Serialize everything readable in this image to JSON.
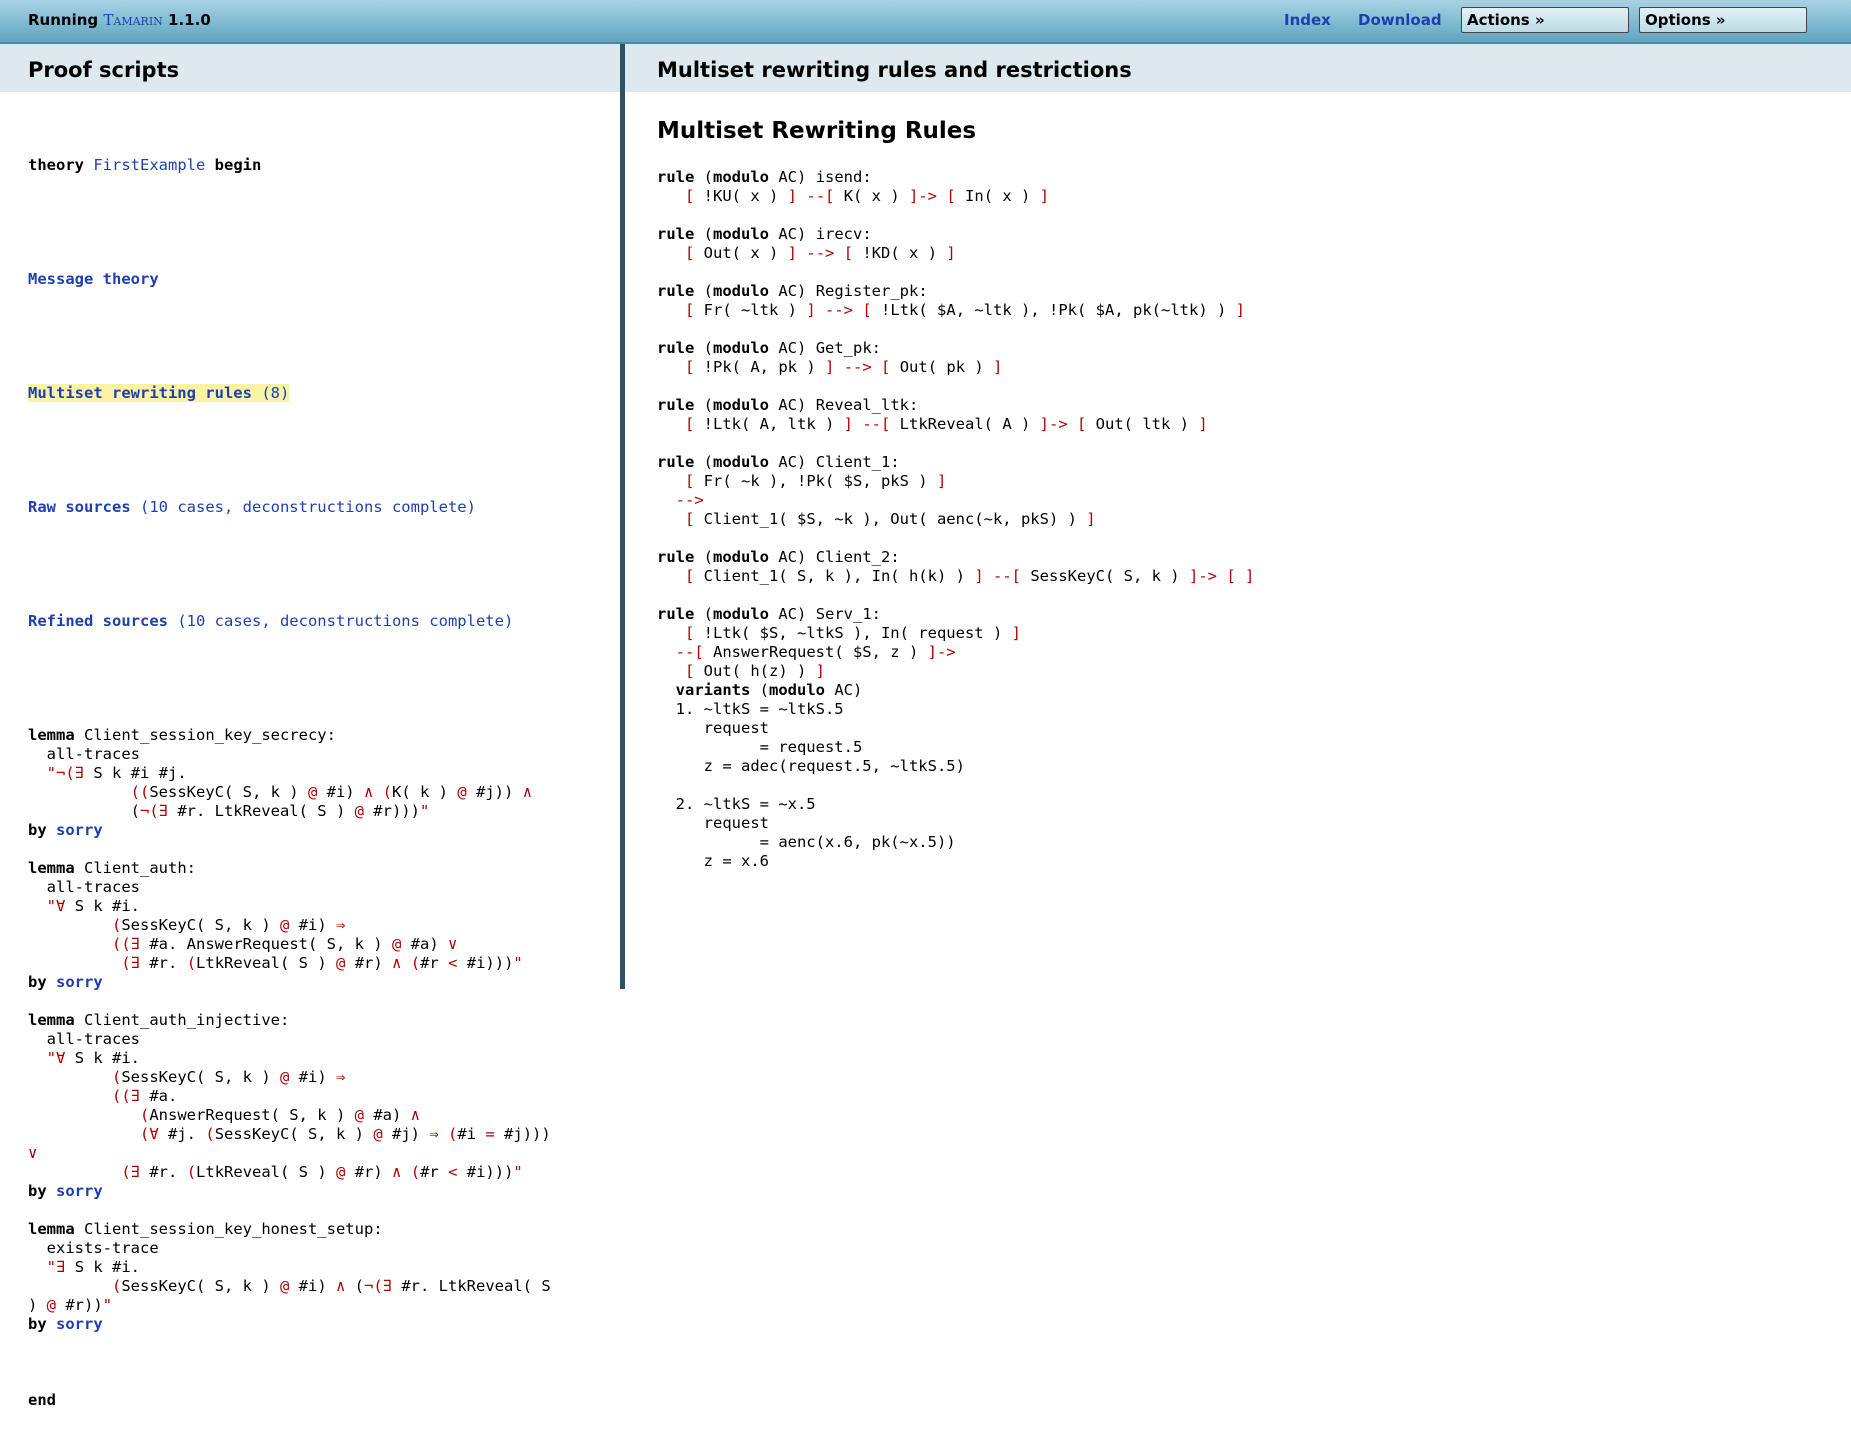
{
  "header": {
    "brand_prefix": "Running",
    "brand_name": "Tamarin",
    "brand_version": "1.1.0",
    "nav": {
      "index": "Index",
      "download": "Download",
      "actions": "Actions »",
      "options": "Options »"
    }
  },
  "left_panel": {
    "title": "Proof scripts",
    "theory_kw": "theory",
    "theory_name": "FirstExample",
    "begin_kw": "begin",
    "message_theory": "Message theory",
    "rules_link": "Multiset rewriting rules",
    "rules_count": "(8)",
    "raw_sources": "Raw sources",
    "raw_sources_info": "(10 cases, deconstructions complete)",
    "refined_sources": "Refined sources",
    "refined_sources_info": "(10 cases, deconstructions complete)",
    "lemma_kw": "lemma",
    "by_kw": "by",
    "sorry": "sorry",
    "end_kw": "end",
    "lemmas": [
      {
        "name": "Client_session_key_secrecy:",
        "lines": [
          "  all-traces",
          "  \"¬(∃ S k #i #j.",
          "           ((SessKeyC( S, k ) @ #i) ∧ (K( k ) @ #j)) ∧",
          "           (¬(∃ #r. LtkReveal( S ) @ #r)))\""
        ]
      },
      {
        "name": "Client_auth:",
        "lines": [
          "  all-traces",
          "  \"∀ S k #i.",
          "         (SessKeyC( S, k ) @ #i) ⇒",
          "         ((∃ #a. AnswerRequest( S, k ) @ #a) ∨",
          "          (∃ #r. (LtkReveal( S ) @ #r) ∧ (#r < #i)))\""
        ]
      },
      {
        "name": "Client_auth_injective:",
        "lines": [
          "  all-traces",
          "  \"∀ S k #i.",
          "         (SessKeyC( S, k ) @ #i) ⇒",
          "         ((∃ #a.",
          "            (AnswerRequest( S, k ) @ #a) ∧",
          "            (∀ #j. (SessKeyC( S, k ) @ #j) ⇒ (#i = #j)))",
          "∨",
          "          (∃ #r. (LtkReveal( S ) @ #r) ∧ (#r < #i)))\""
        ]
      },
      {
        "name": "Client_session_key_honest_setup:",
        "lines": [
          "  exists-trace",
          "  \"∃ S k #i.",
          "         (SessKeyC( S, k ) @ #i) ∧ (¬(∃ #r. LtkReveal( S",
          ") @ #r))\""
        ]
      }
    ]
  },
  "right_panel": {
    "title": "Multiset rewriting rules and restrictions",
    "section_title": "Multiset Rewriting Rules",
    "rule_kw": "rule",
    "modulo_kw": "modulo",
    "ac": "AC)",
    "rules": [
      {
        "name": "isend:",
        "body": [
          "   [ !KU( x ) ] --[ K( x ) ]-> [ In( x ) ]"
        ]
      },
      {
        "name": "irecv:",
        "body": [
          "   [ Out( x ) ] --> [ !KD( x ) ]"
        ]
      },
      {
        "name": "Register_pk:",
        "body": [
          "   [ Fr( ~ltk ) ] --> [ !Ltk( $A, ~ltk ), !Pk( $A, pk(~ltk) ) ]"
        ]
      },
      {
        "name": "Get_pk:",
        "body": [
          "   [ !Pk( A, pk ) ] --> [ Out( pk ) ]"
        ]
      },
      {
        "name": "Reveal_ltk:",
        "body": [
          "   [ !Ltk( A, ltk ) ] --[ LtkReveal( A ) ]-> [ Out( ltk ) ]"
        ]
      },
      {
        "name": "Client_1:",
        "body": [
          "   [ Fr( ~k ), !Pk( $S, pkS ) ]",
          "  -->",
          "   [ Client_1( $S, ~k ), Out( aenc(~k, pkS) ) ]"
        ]
      },
      {
        "name": "Client_2:",
        "body": [
          "   [ Client_1( S, k ), In( h(k) ) ] --[ SessKeyC( S, k ) ]-> [ ]"
        ]
      },
      {
        "name": "Serv_1:",
        "body": [
          "   [ !Ltk( $S, ~ltkS ), In( request ) ]",
          "  --[ AnswerRequest( $S, z ) ]->",
          "   [ Out( h(z) ) ]"
        ]
      }
    ],
    "variants_kw": "variants",
    "variants": [
      "  1. ~ltkS = ~ltkS.5",
      "     request",
      "           = request.5",
      "     z = adec(request.5, ~ltkS.5)",
      "",
      "  2. ~ltkS = ~x.5",
      "     request",
      "           = aenc(x.6, pk(~x.5))",
      "     z = x.6"
    ]
  }
}
